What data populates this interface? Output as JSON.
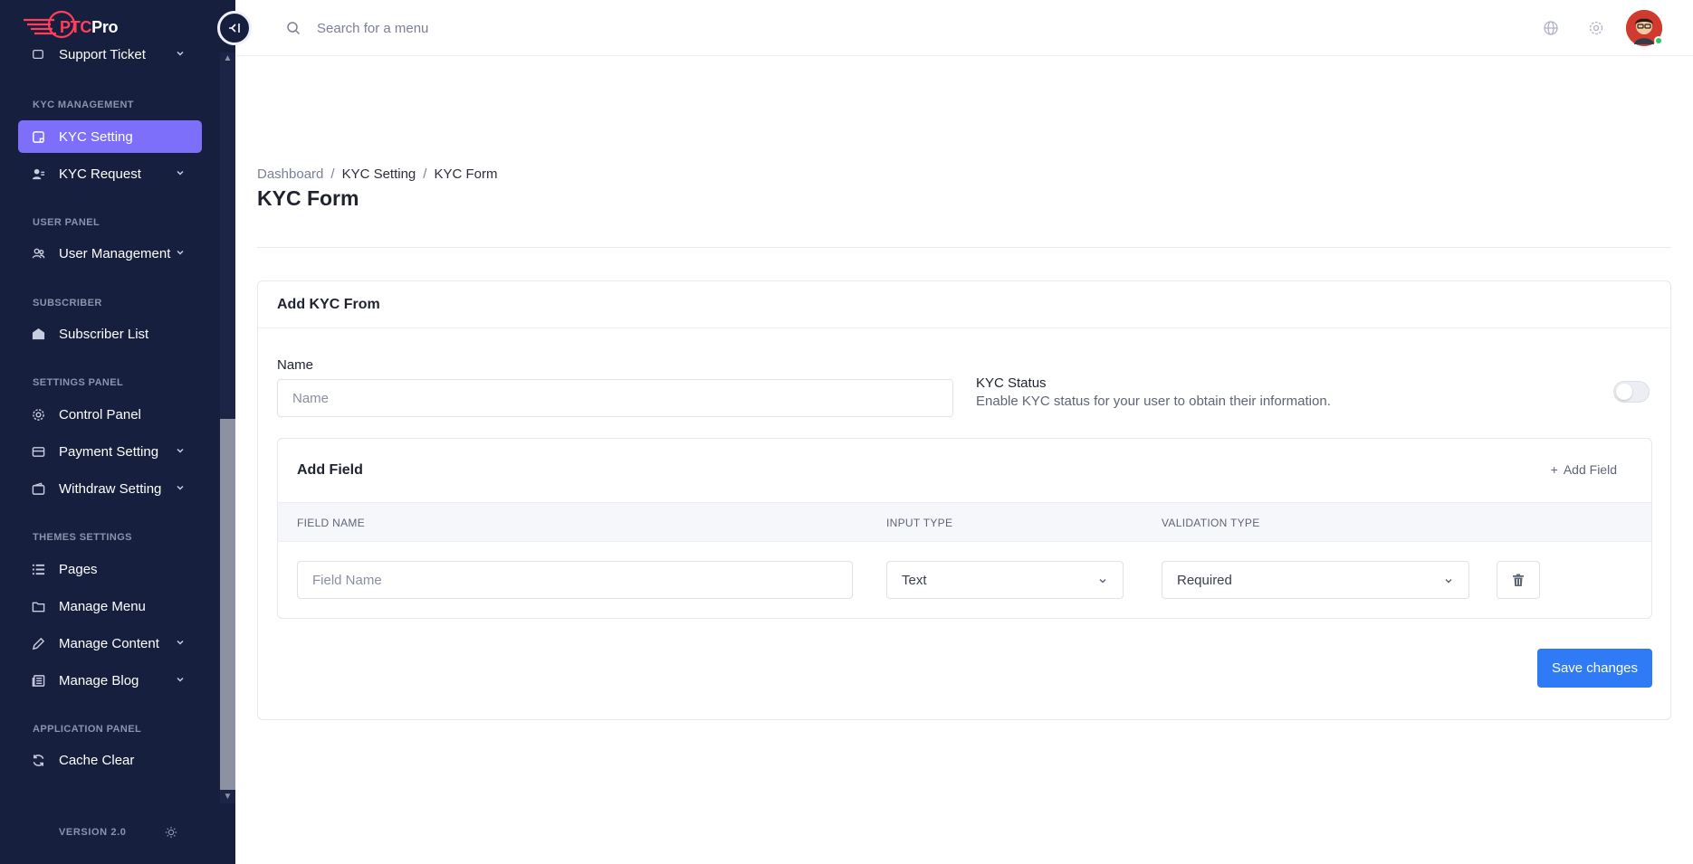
{
  "brand": {
    "logo_text_ptc": "PTC",
    "logo_text_pro": "Pro"
  },
  "sidebar": {
    "partial_item": "Support Ticket",
    "sections": [
      {
        "title": "KYC MANAGEMENT",
        "items": [
          {
            "label": "KYC Setting",
            "icon": "document-icon",
            "active": true
          },
          {
            "label": "KYC Request",
            "icon": "users-icon",
            "has_submenu": true
          }
        ]
      },
      {
        "title": "USER PANEL",
        "items": [
          {
            "label": "User Management",
            "icon": "user-group-icon",
            "has_submenu": true
          }
        ]
      },
      {
        "title": "SUBSCRIBER",
        "items": [
          {
            "label": "Subscriber List",
            "icon": "envelope-icon"
          }
        ]
      },
      {
        "title": "SETTINGS PANEL",
        "items": [
          {
            "label": "Control Panel",
            "icon": "gear-icon"
          },
          {
            "label": "Payment Setting",
            "icon": "card-icon",
            "has_submenu": true
          },
          {
            "label": "Withdraw Setting",
            "icon": "wallet-icon",
            "has_submenu": true
          }
        ]
      },
      {
        "title": "THEMES SETTINGS",
        "items": [
          {
            "label": "Pages",
            "icon": "list-icon"
          },
          {
            "label": "Manage Menu",
            "icon": "folder-icon"
          },
          {
            "label": "Manage Content",
            "icon": "pencil-icon",
            "has_submenu": true
          },
          {
            "label": "Manage Blog",
            "icon": "newspaper-icon",
            "has_submenu": true
          }
        ]
      },
      {
        "title": "APPLICATION PANEL",
        "items": [
          {
            "label": "Cache Clear",
            "icon": "refresh-icon"
          }
        ]
      }
    ],
    "version": "VERSION 2.0"
  },
  "topbar": {
    "search_placeholder": "Search for a menu"
  },
  "breadcrumb": {
    "items": [
      "Dashboard",
      "KYC Setting",
      "KYC Form"
    ],
    "separator": "/"
  },
  "page_title": "KYC Form",
  "card": {
    "title": "Add KYC From",
    "name_label": "Name",
    "name_placeholder": "Name",
    "kyc_status_label": "KYC Status",
    "kyc_status_desc": "Enable KYC status for your user to obtain their information.",
    "kyc_status_enabled": false,
    "field_box": {
      "title": "Add Field",
      "add_button": "Add Field",
      "add_button_prefix": "+",
      "columns": [
        "FIELD NAME",
        "INPUT TYPE",
        "VALIDATION TYPE"
      ],
      "row": {
        "field_placeholder": "Field Name",
        "input_type": "Text",
        "validation_type": "Required"
      }
    },
    "save_button": "Save changes"
  },
  "colors": {
    "sidebar_bg": "#161f3d",
    "active_item": "#7d6ff9",
    "primary": "#2f7bf6",
    "brand_red": "#ff3f5a"
  }
}
